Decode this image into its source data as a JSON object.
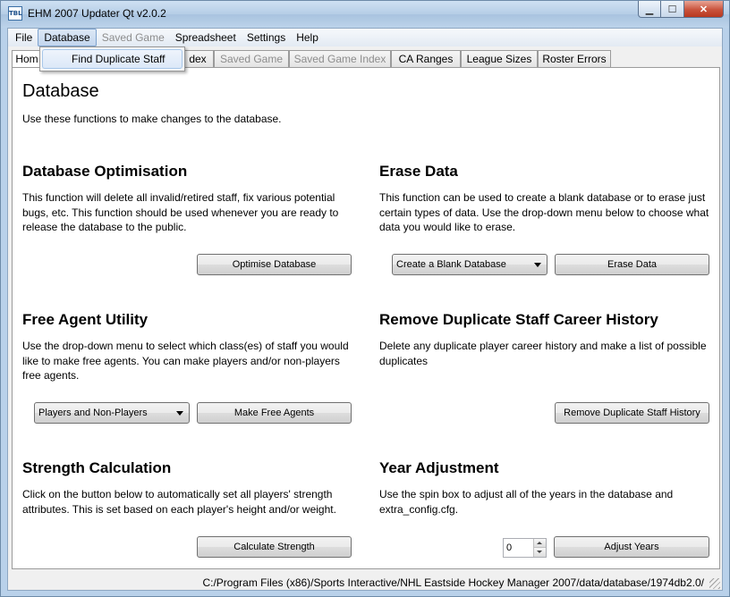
{
  "window": {
    "title": "EHM 2007 Updater Qt v2.0.2",
    "icon_text": "TBL"
  },
  "menu": {
    "items": [
      "File",
      "Database",
      "Saved Game",
      "Spreadsheet",
      "Settings",
      "Help"
    ],
    "dropdown_item": "Find Duplicate Staff"
  },
  "tabs": [
    "Hom",
    "dex",
    "Saved Game",
    "Saved Game Index",
    "CA Ranges",
    "League Sizes",
    "Roster Errors"
  ],
  "page": {
    "title": "Database",
    "intro": "Use these functions to make changes to the database."
  },
  "sections": {
    "optimise": {
      "heading": "Database Optimisation",
      "text": "This function will delete all invalid/retired staff, fix various potential bugs, etc. This function should be used whenever you are ready to release the database to the public.",
      "button": "Optimise Database"
    },
    "erase": {
      "heading": "Erase Data",
      "text": "This function can be used to create a blank database or to erase just certain types of data. Use the drop-down menu below to choose what data you would like to erase.",
      "combo_value": "Create a Blank Database",
      "button": "Erase Data"
    },
    "free_agent": {
      "heading": "Free Agent Utility",
      "text": "Use the drop-down menu to select which class(es) of staff you would like to make free agents. You can make players and/or non-players free agents.",
      "combo_value": "Players and Non-Players",
      "button": "Make Free Agents"
    },
    "duplicate": {
      "heading": "Remove Duplicate Staff Career History",
      "text": "Delete any duplicate player career history and make a list of possible duplicates",
      "button": "Remove Duplicate Staff History"
    },
    "strength": {
      "heading": "Strength Calculation",
      "text": "Click on the button below to automatically set all players' strength attributes. This is set based on each player's height and/or weight.",
      "button": "Calculate Strength"
    },
    "year": {
      "heading": "Year Adjustment",
      "text": "Use the spin box to adjust all of the years in the database and extra_config.cfg.",
      "spin_value": "0",
      "button": "Adjust Years"
    }
  },
  "status": {
    "path": "C:/Program Files (x86)/Sports Interactive/NHL Eastside Hockey Manager 2007/data/database/1974db2.0/"
  }
}
